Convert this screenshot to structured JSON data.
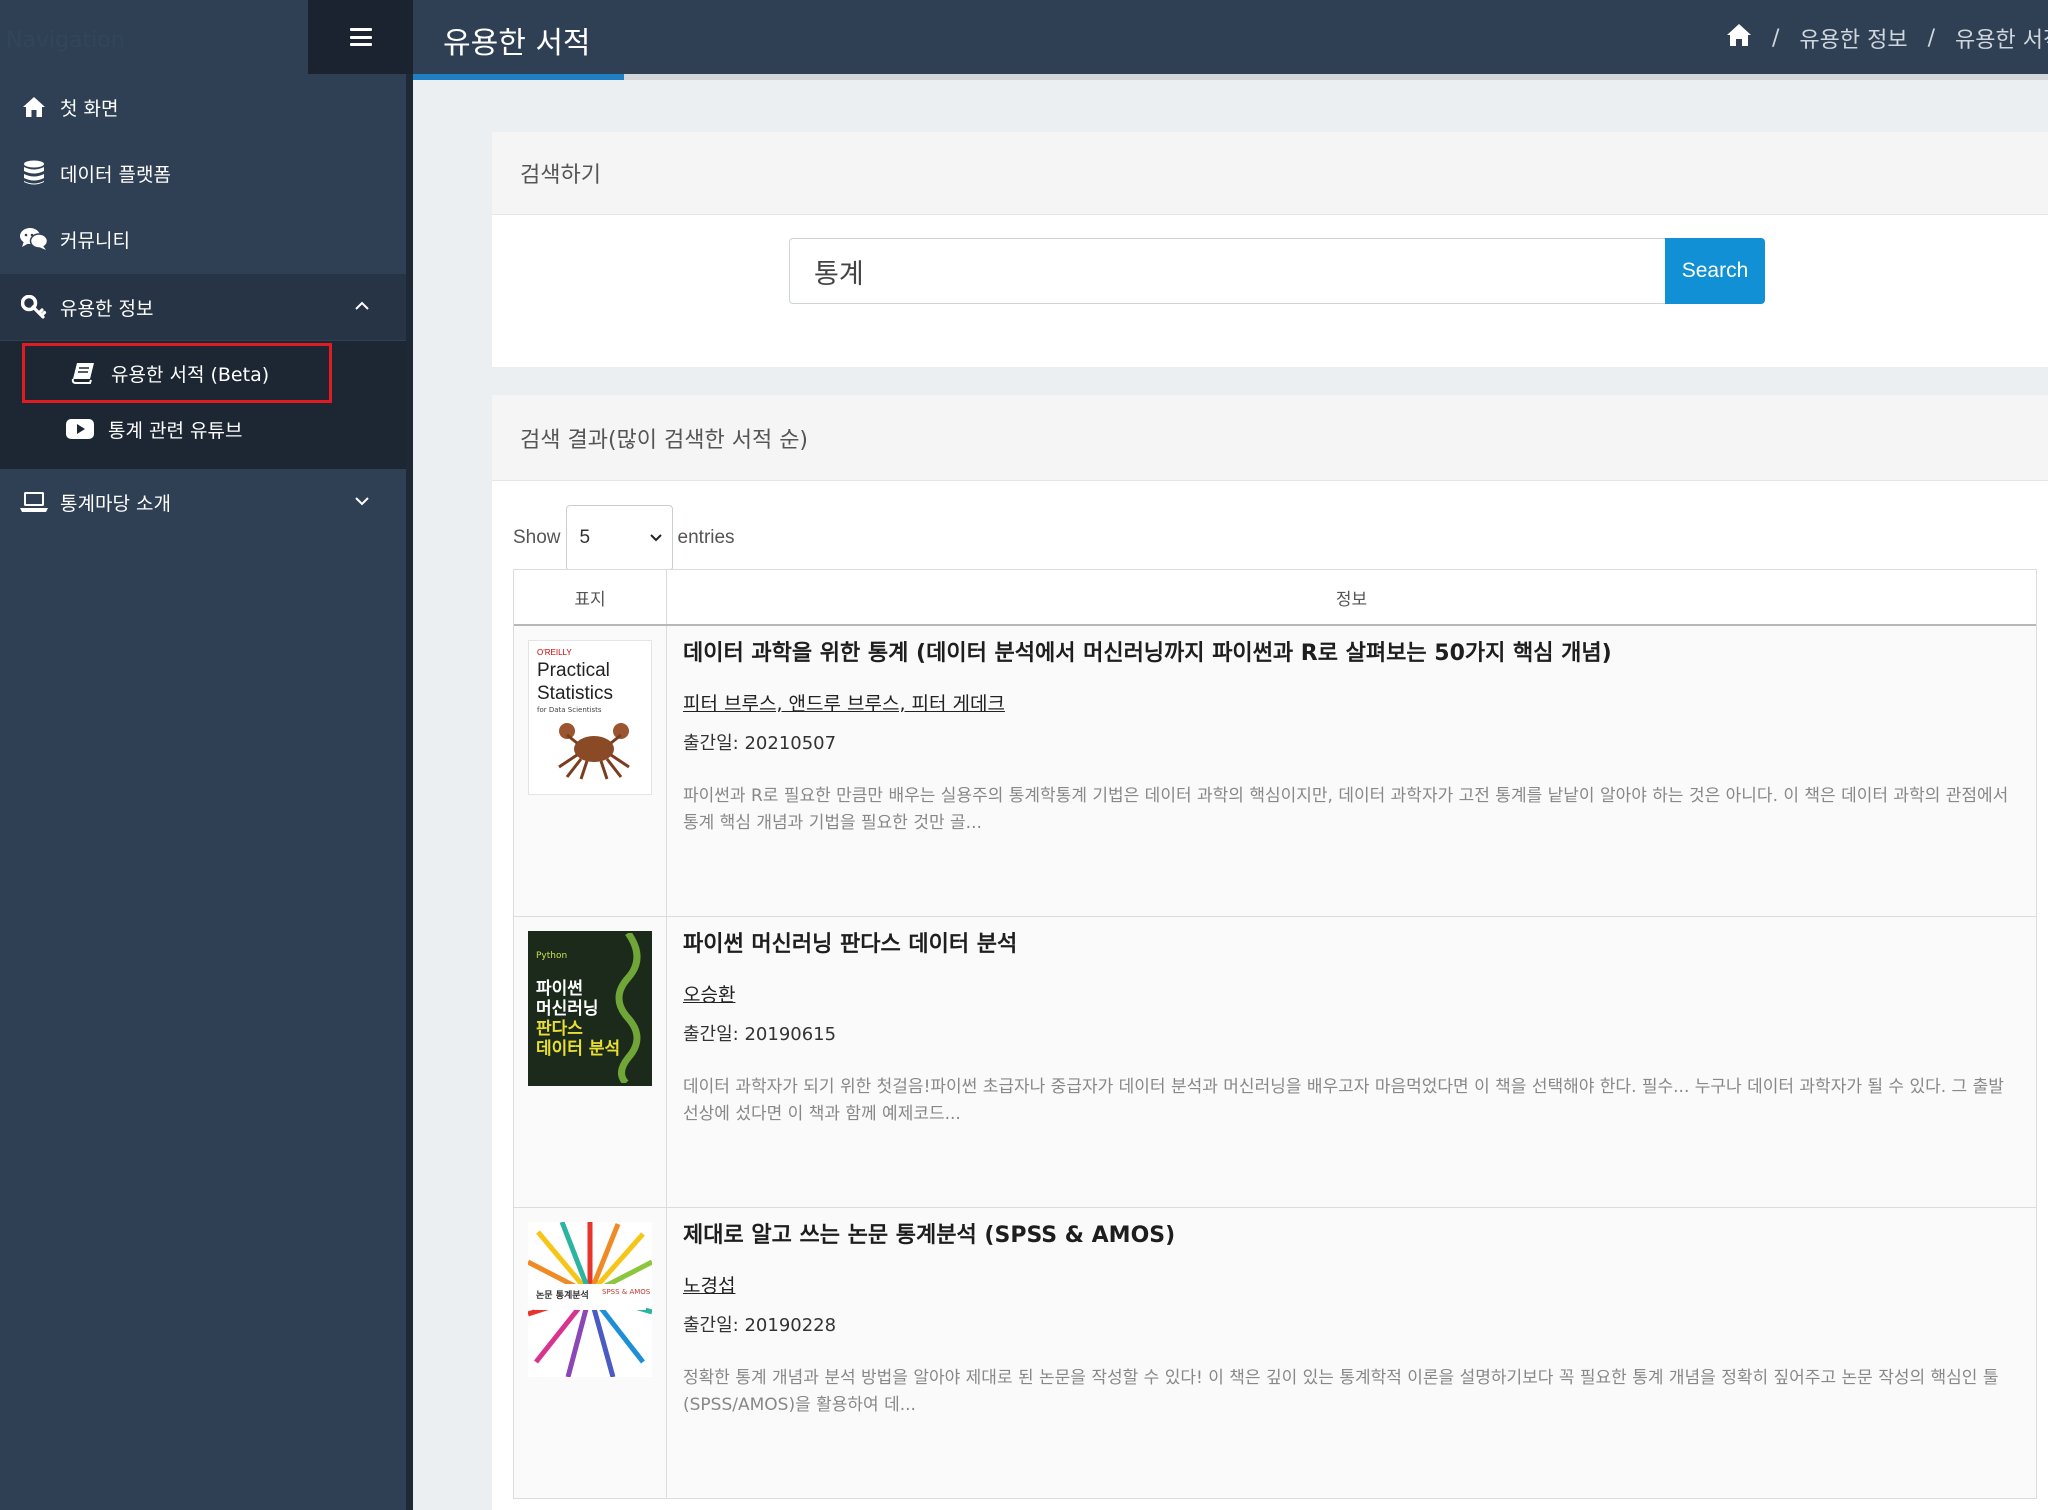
{
  "sidebar": {
    "brand": "Navigation",
    "menu": [
      {
        "label": "첫 화면",
        "icon": "home-icon"
      },
      {
        "label": "데이터 플랫폼",
        "icon": "database-icon"
      },
      {
        "label": "커뮤니티",
        "icon": "chat-bubbles-icon"
      },
      {
        "label": "유용한 정보",
        "icon": "key-icon"
      },
      {
        "label": "통계마당 소개",
        "icon": "laptop-icon"
      }
    ],
    "submenu": [
      {
        "label": "유용한 서적 (Beta)",
        "icon": "book-icon"
      },
      {
        "label": "통계 관련 유튜브",
        "icon": "youtube-icon"
      }
    ]
  },
  "header": {
    "title": "유용한 서적",
    "breadcrumb": [
      "유용한 정보",
      "유용한 서적"
    ]
  },
  "search_card": {
    "title": "검색하기",
    "query": "통계",
    "button_label": "Search"
  },
  "results": {
    "title": "검색 결과(많이 검색한 서적 순)",
    "show_label": "Show",
    "entries_value": "5",
    "entries_label": "entries",
    "columns": [
      "표지",
      "정보"
    ],
    "books": [
      {
        "title": "데이터 과학을 위한 통계 (데이터 분석에서 머신러닝까지 파이썬과 R로 살펴보는 50가지 핵심 개념)",
        "authors": "피터 브루스, 앤드루 브루스, 피터 게데크",
        "date": "출간일: 20210507",
        "desc": "파이썬과 R로 필요한 만큼만 배우는 실용주의 통계학통계 기법은 데이터 과학의 핵심이지만, 데이터 과학자가 고전 통계를 낱낱이 알아야 하는 것은 아니다. 이 책은 데이터 과학의 관점에서 통계 핵심 개념과 기법을 필요한 것만 골...",
        "cover": {
          "publisher": "O'REILLY",
          "title_line1": "Practical",
          "title_line2": "Statistics",
          "subtitle": "for Data Scientists"
        }
      },
      {
        "title": "파이썬 머신러닝 판다스 데이터 분석",
        "authors": "오승환",
        "date": "출간일: 20190615",
        "desc": "데이터 과학자가 되기 위한 첫걸음!파이썬 초급자나 중급자가 데이터 분석과 머신러닝을 배우고자 마음먹었다면 이 책을 선택해야 한다. 필수... 누구나 데이터 과학자가 될 수 있다. 그 출발 선상에 섰다면 이 책과 함께 예제코드...",
        "cover": {
          "line1": "파이썬",
          "line2": "머신러닝",
          "line3": "판다스",
          "line4": "데이터 분석",
          "tag": "Python"
        }
      },
      {
        "title": "제대로 알고 쓰는 논문 통계분석 (SPSS & AMOS)",
        "authors": "노경섭",
        "date": "출간일: 20190228",
        "desc": "정확한 통계 개념과 분석 방법을 알아야 제대로 된 논문을 작성할 수 있다! 이 책은 깊이 있는 통계학적 이론을 설명하기보다 꼭 필요한 통계 개념을 정확히 짚어주고 논문 작성의 핵심인 툴(SPSS/AMOS)을 활용하여 데...",
        "cover": {
          "title": "논문 통계분석",
          "tag": "SPSS & AMOS"
        }
      }
    ]
  },
  "colors": {
    "sidebar_bg": "#2f4055",
    "accent": "#1190d6",
    "highlight_border": "#e01b22"
  }
}
